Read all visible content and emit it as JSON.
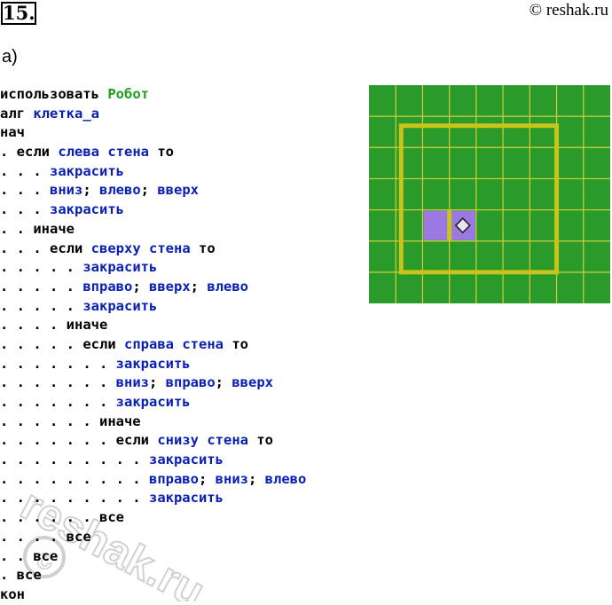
{
  "header": {
    "problem_number": "15.",
    "copyright": "© reshak.ru"
  },
  "part_label": "а)",
  "code_lines": [
    [
      [
        "kw",
        "использовать "
      ],
      [
        "exec",
        "Робот"
      ]
    ],
    [
      [
        "kw",
        "алг "
      ],
      [
        "cmd",
        "клетка_а"
      ]
    ],
    [
      [
        "kw",
        "нач"
      ]
    ],
    [
      [
        "dots",
        ". "
      ],
      [
        "kw",
        "если "
      ],
      [
        "cmd",
        "слева стена"
      ],
      [
        "kw",
        " то"
      ]
    ],
    [
      [
        "dots",
        ". . . "
      ],
      [
        "cmd",
        "закрасить"
      ]
    ],
    [
      [
        "dots",
        ". . . "
      ],
      [
        "cmd",
        "вниз"
      ],
      [
        "kw",
        "; "
      ],
      [
        "cmd",
        "влево"
      ],
      [
        "kw",
        "; "
      ],
      [
        "cmd",
        "вверх"
      ]
    ],
    [
      [
        "dots",
        ". . . "
      ],
      [
        "cmd",
        "закрасить"
      ]
    ],
    [
      [
        "dots",
        ". . "
      ],
      [
        "kw",
        "иначе"
      ]
    ],
    [
      [
        "dots",
        ". . . "
      ],
      [
        "kw",
        "если "
      ],
      [
        "cmd",
        "сверху стена"
      ],
      [
        "kw",
        " то"
      ]
    ],
    [
      [
        "dots",
        ". . . . . "
      ],
      [
        "cmd",
        "закрасить"
      ]
    ],
    [
      [
        "dots",
        ". . . . . "
      ],
      [
        "cmd",
        "вправо"
      ],
      [
        "kw",
        "; "
      ],
      [
        "cmd",
        "вверх"
      ],
      [
        "kw",
        "; "
      ],
      [
        "cmd",
        "влево"
      ]
    ],
    [
      [
        "dots",
        ". . . . . "
      ],
      [
        "cmd",
        "закрасить"
      ]
    ],
    [
      [
        "dots",
        ". . . . "
      ],
      [
        "kw",
        "иначе"
      ]
    ],
    [
      [
        "dots",
        ". . . . . "
      ],
      [
        "kw",
        "если "
      ],
      [
        "cmd",
        "справа стена"
      ],
      [
        "kw",
        " то"
      ]
    ],
    [
      [
        "dots",
        ". . . . . . . "
      ],
      [
        "cmd",
        "закрасить"
      ]
    ],
    [
      [
        "dots",
        ". . . . . . . "
      ],
      [
        "cmd",
        "вниз"
      ],
      [
        "kw",
        "; "
      ],
      [
        "cmd",
        "вправо"
      ],
      [
        "kw",
        "; "
      ],
      [
        "cmd",
        "вверх"
      ]
    ],
    [
      [
        "dots",
        ". . . . . . . "
      ],
      [
        "cmd",
        "закрасить"
      ]
    ],
    [
      [
        "dots",
        ". . . . . . "
      ],
      [
        "kw",
        "иначе"
      ]
    ],
    [
      [
        "dots",
        ". . . . . . . "
      ],
      [
        "kw",
        "если "
      ],
      [
        "cmd",
        "снизу стена"
      ],
      [
        "kw",
        " то"
      ]
    ],
    [
      [
        "dots",
        ". . . . . . . . . "
      ],
      [
        "cmd",
        "закрасить"
      ]
    ],
    [
      [
        "dots",
        ". . . . . . . . . "
      ],
      [
        "cmd",
        "вправо"
      ],
      [
        "kw",
        "; "
      ],
      [
        "cmd",
        "вниз"
      ],
      [
        "kw",
        "; "
      ],
      [
        "cmd",
        "влево"
      ]
    ],
    [
      [
        "dots",
        ". . . . . . . . . "
      ],
      [
        "cmd",
        "закрасить"
      ]
    ],
    [
      [
        "dots",
        ". . . . . . "
      ],
      [
        "kw",
        "все"
      ]
    ],
    [
      [
        "dots",
        ". . . . "
      ],
      [
        "kw",
        "все"
      ]
    ],
    [
      [
        "dots",
        ". . "
      ],
      [
        "kw",
        "все"
      ]
    ],
    [
      [
        "dots",
        ". "
      ],
      [
        "kw",
        "все"
      ]
    ],
    [
      [
        "kw",
        "кон"
      ]
    ]
  ],
  "field": {
    "cols": 9,
    "rows": 7,
    "background_color": "#2a9a2a",
    "grid_color": "#d4cf3a",
    "wall_color": "#c8c41a",
    "painted_color": "#9a79e0",
    "robot_icon": "robot-diamond-icon",
    "painted_cells": [
      [
        2,
        4
      ],
      [
        3,
        4
      ]
    ],
    "robot_cell": [
      3,
      4
    ]
  },
  "watermark": "reshak.ru"
}
